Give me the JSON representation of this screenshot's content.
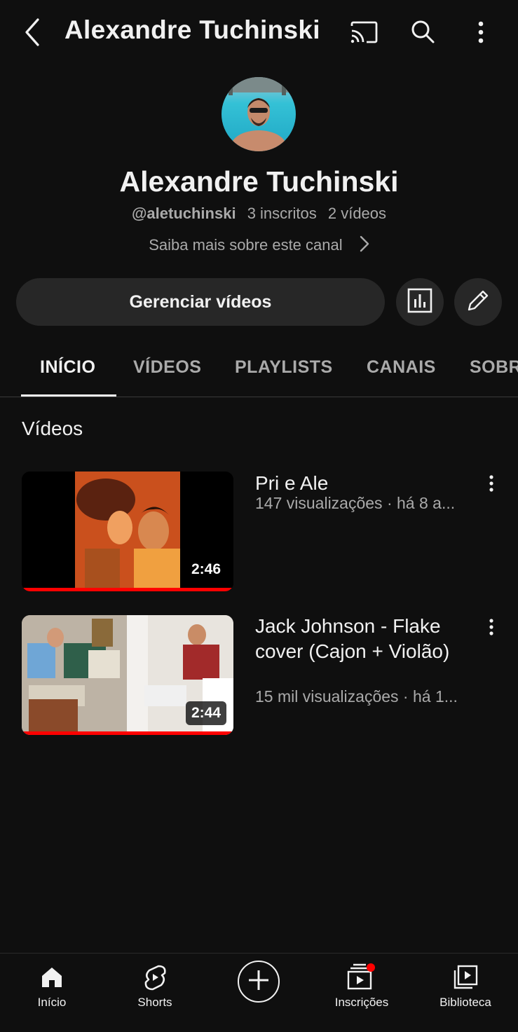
{
  "topbar": {
    "title": "Alexandre Tuchinski",
    "back_icon": "back-arrow-icon",
    "cast_icon": "cast-icon",
    "search_icon": "search-icon",
    "more_icon": "more-vert-icon"
  },
  "channel": {
    "name": "Alexandre Tuchinski",
    "handle": "@aletuchinski",
    "subscribers": "3 inscritos",
    "video_count": "2 vídeos",
    "about_link": "Saiba mais sobre este canal"
  },
  "actions": {
    "manage_videos": "Gerenciar vídeos",
    "analytics_icon": "analytics-icon",
    "edit_icon": "pencil-icon"
  },
  "tabs": [
    {
      "label": "INÍCIO",
      "active": true
    },
    {
      "label": "VÍDEOS",
      "active": false
    },
    {
      "label": "PLAYLISTS",
      "active": false
    },
    {
      "label": "CANAIS",
      "active": false
    },
    {
      "label": "SOBRE",
      "active": false
    }
  ],
  "section": {
    "title": "Vídeos"
  },
  "videos": [
    {
      "title": "Pri e Ale",
      "meta": "147 visualizações · há 8 a...",
      "duration": "2:46",
      "watched": 1.0
    },
    {
      "title": "Jack Johnson - Flake cover (Cajon + Violão)",
      "meta": "15 mil visualizações · há 1...",
      "duration": "2:44",
      "watched": 1.0
    }
  ],
  "bottom_nav": [
    {
      "label": "Início",
      "icon": "home-icon"
    },
    {
      "label": "Shorts",
      "icon": "shorts-icon"
    },
    {
      "label": "",
      "icon": "create-plus-icon"
    },
    {
      "label": "Inscrições",
      "icon": "subscriptions-icon"
    },
    {
      "label": "Biblioteca",
      "icon": "library-icon"
    }
  ],
  "colors": {
    "background": "#0f0f0f",
    "surface": "#272727",
    "text_primary": "#f1f1f1",
    "text_secondary": "#aaaaaa",
    "accent_red": "#ff0000"
  }
}
